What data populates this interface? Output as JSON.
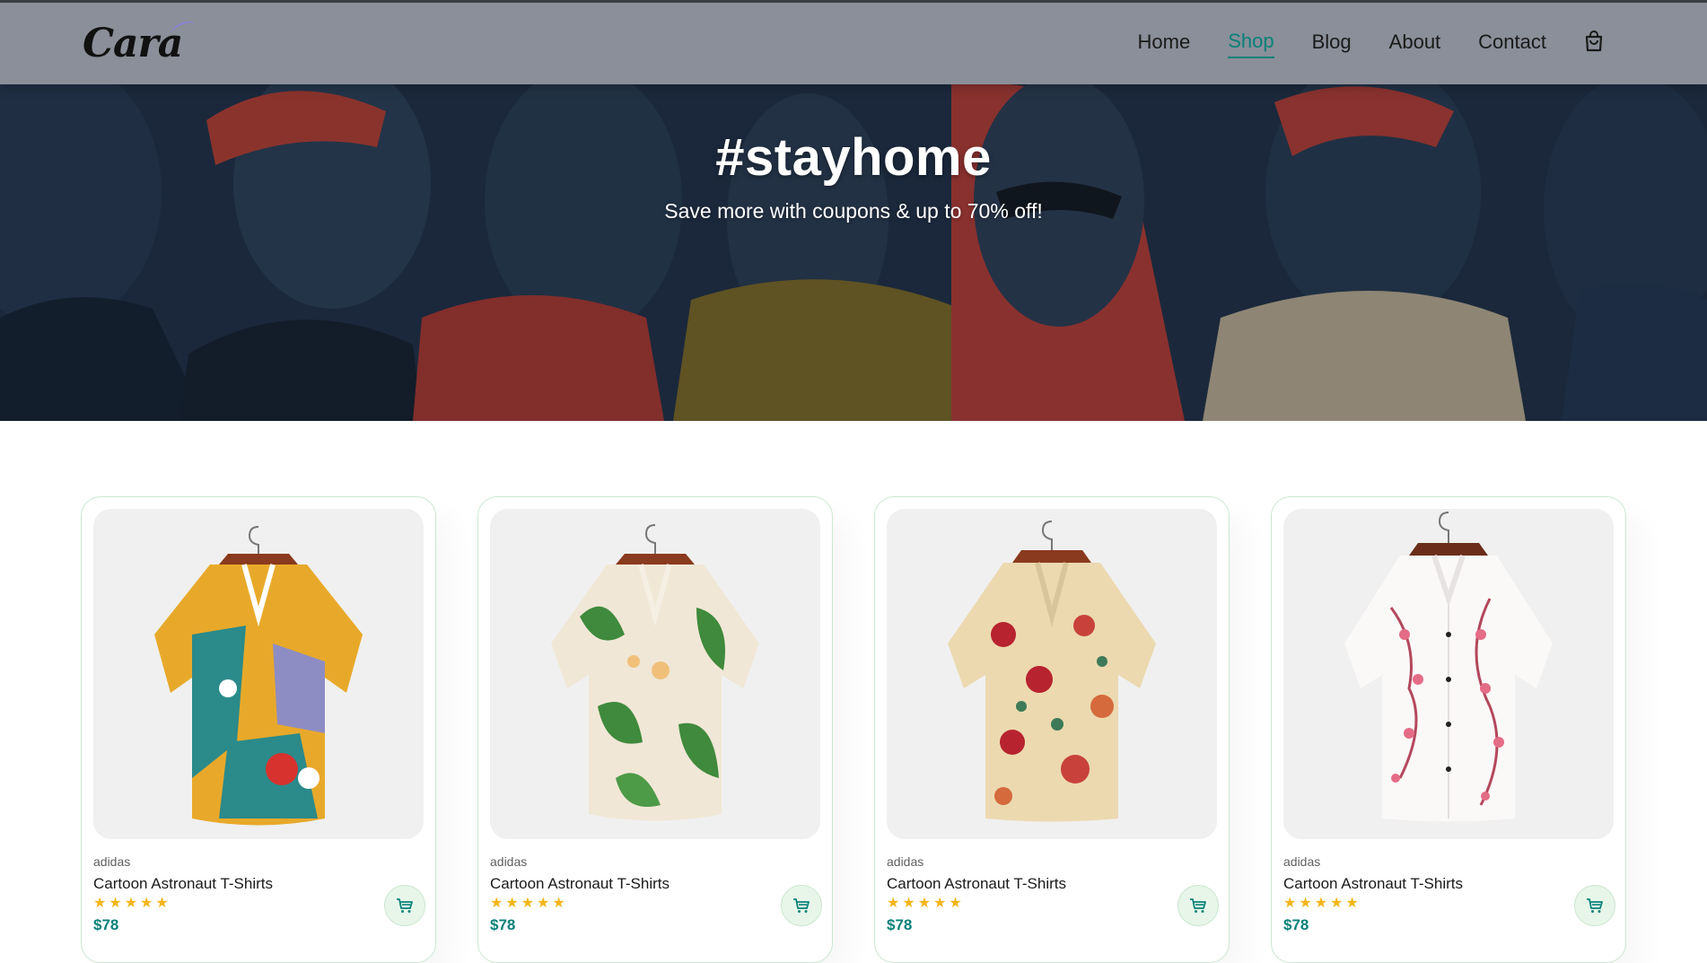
{
  "header": {
    "logo_text": "Cara",
    "nav": [
      {
        "label": "Home",
        "active": false
      },
      {
        "label": "Shop",
        "active": true
      },
      {
        "label": "Blog",
        "active": false
      },
      {
        "label": "About",
        "active": false
      },
      {
        "label": "Contact",
        "active": false
      }
    ],
    "cart_icon": "shopping-bag-icon"
  },
  "hero": {
    "title": "#stayhome",
    "subtitle": "Save more with coupons & up to 70% off!"
  },
  "products": [
    {
      "brand": "adidas",
      "name": "Cartoon Astronaut T-Shirts",
      "rating": 5,
      "price": "$78",
      "stars": "★★★★★",
      "pattern": "abstract-colorblock"
    },
    {
      "brand": "adidas",
      "name": "Cartoon Astronaut T-Shirts",
      "rating": 5,
      "price": "$78",
      "stars": "★★★★★",
      "pattern": "lily-leaves"
    },
    {
      "brand": "adidas",
      "name": "Cartoon Astronaut T-Shirts",
      "rating": 5,
      "price": "$78",
      "stars": "★★★★★",
      "pattern": "floral-roses"
    },
    {
      "brand": "adidas",
      "name": "Cartoon Astronaut T-Shirts",
      "rating": 5,
      "price": "$78",
      "stars": "★★★★★",
      "pattern": "cherry-blossom"
    }
  ],
  "colors": {
    "accent": "#088178",
    "star": "#f3b519",
    "header_bg": "#8a8f99",
    "card_border": "#cce7d0"
  }
}
